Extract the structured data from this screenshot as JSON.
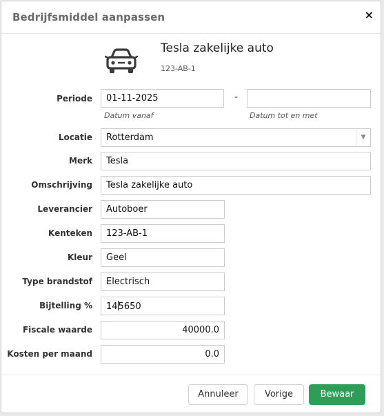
{
  "dialog": {
    "title": "Bedrijfsmiddel aanpassen",
    "close_symbol": "×"
  },
  "asset": {
    "icon": "car-icon",
    "name": "Tesla zakelijke auto",
    "plate": "123-AB-1"
  },
  "form": {
    "periode": {
      "label": "Periode",
      "from_value": "01-11-2025",
      "to_value": "",
      "separator": "-",
      "from_hint": "Datum vanaf",
      "to_hint": "Datum tot en met"
    },
    "locatie": {
      "label": "Locatie",
      "value": "Rotterdam"
    },
    "merk": {
      "label": "Merk",
      "value": "Tesla"
    },
    "omschrijving": {
      "label": "Omschrijving",
      "value": "Tesla zakelijke auto"
    },
    "leverancier": {
      "label": "Leverancier",
      "value": "Autoboer"
    },
    "kenteken": {
      "label": "Kenteken",
      "value": "123-AB-1"
    },
    "kleur": {
      "label": "Kleur",
      "value": "Geel"
    },
    "type_brandstof": {
      "label": "Type brandstof",
      "value": "Electrisch"
    },
    "bijtelling": {
      "label": "Bijtelling %",
      "value_before_caret": "14",
      "value_after_caret": "5650"
    },
    "fiscale_waarde": {
      "label": "Fiscale waarde",
      "value": "40000.0"
    },
    "kosten_per_maand": {
      "label": "Kosten per maand",
      "value": "0.0"
    }
  },
  "buttons": {
    "cancel": "Annuleer",
    "previous": "Vorige",
    "save": "Bewaar"
  },
  "colors": {
    "primary": "#2e9e57"
  }
}
